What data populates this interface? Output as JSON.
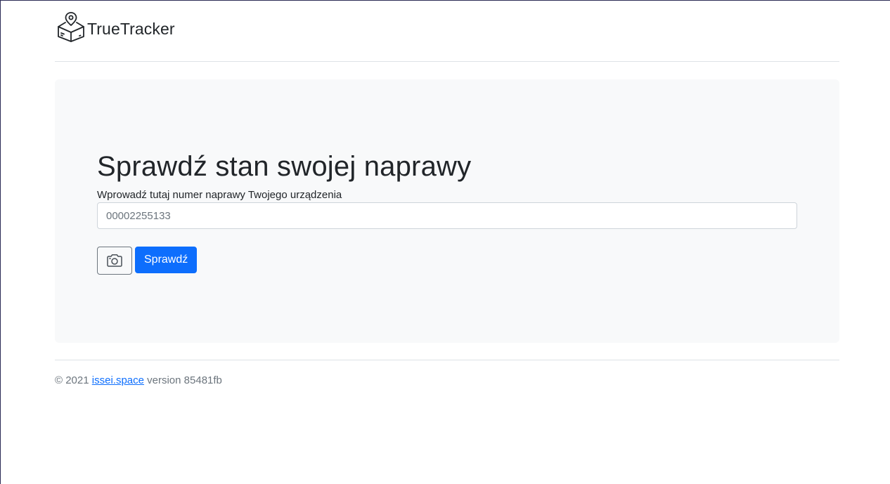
{
  "header": {
    "brand_name": "TrueTracker",
    "logo_icon": "box-location-pin-icon"
  },
  "hero": {
    "title": "Sprawdź stan swojej naprawy",
    "field_label": "Wprowadź tutaj numer naprawy Twojego urządzenia",
    "input_value": "",
    "input_placeholder": "00002255133",
    "camera_icon": "camera-icon",
    "submit_label": "Sprawdź"
  },
  "footer": {
    "copyright": "© 2021",
    "link_text": "issei.space",
    "version_text": "version 85481fb"
  },
  "colors": {
    "primary": "#0d6efd",
    "hero_background": "#f8f9fa",
    "muted_text": "#6c757d",
    "divider": "#dee2e6"
  }
}
